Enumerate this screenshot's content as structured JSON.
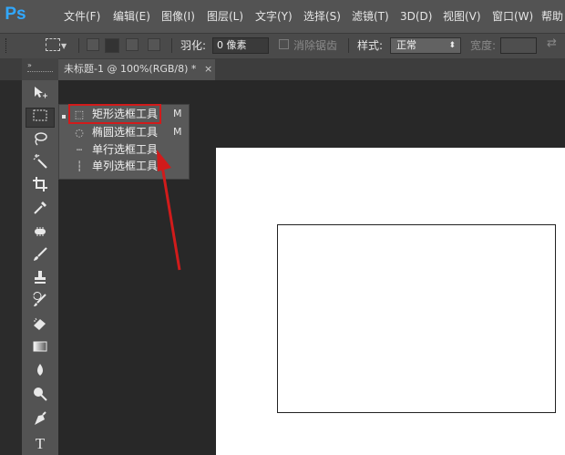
{
  "app": {
    "logo": "Ps"
  },
  "menu": [
    "文件(F)",
    "编辑(E)",
    "图像(I)",
    "图层(L)",
    "文字(Y)",
    "选择(S)",
    "滤镜(T)",
    "3D(D)",
    "视图(V)",
    "窗口(W)",
    "帮助"
  ],
  "options": {
    "feather_label": "羽化:",
    "feather_value": "0 像素",
    "antialias_label": "消除锯齿",
    "style_label": "样式:",
    "style_value": "正常",
    "width_label": "宽度:"
  },
  "document_tab": {
    "title": "未标题-1 @ 100%(RGB/8) *",
    "close": "×"
  },
  "flyout": [
    {
      "label": "矩形选框工具",
      "shortcut": "M",
      "icon": "rect-marquee-icon",
      "selected": true
    },
    {
      "label": "椭圆选框工具",
      "shortcut": "M",
      "icon": "ellipse-marquee-icon",
      "selected": false
    },
    {
      "label": "单行选框工具",
      "shortcut": "",
      "icon": "single-row-marquee-icon",
      "selected": false
    },
    {
      "label": "单列选框工具",
      "shortcut": "",
      "icon": "single-column-marquee-icon",
      "selected": false
    }
  ],
  "tools": [
    "move-icon",
    "marquee-icon",
    "lasso-icon",
    "magic-wand-icon",
    "crop-icon",
    "eyedropper-icon",
    "healing-brush-icon",
    "brush-icon",
    "clone-stamp-icon",
    "history-brush-icon",
    "eraser-icon",
    "gradient-icon",
    "blur-icon",
    "dodge-icon",
    "pen-icon",
    "type-icon"
  ],
  "tool_glyphs": {
    "type": "T"
  },
  "colors": {
    "accent_logo": "#31a8ff",
    "annotation": "#d11b1b",
    "canvas": "#ffffff"
  }
}
